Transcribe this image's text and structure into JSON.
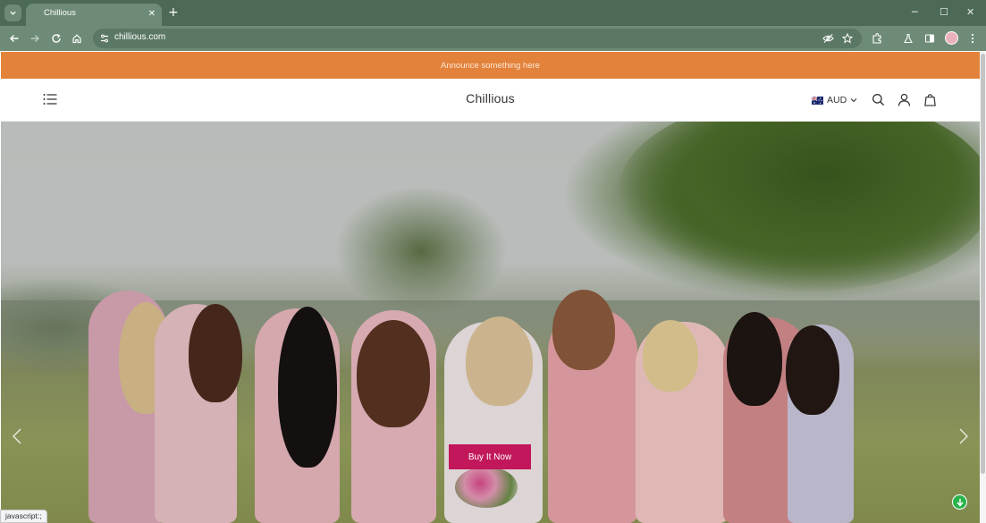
{
  "browser": {
    "tab": {
      "title": "Chillious"
    },
    "address_bar": {
      "url": "chillious.com"
    },
    "status_text": "javascript:;"
  },
  "announcement": {
    "text": "Announce something here"
  },
  "header": {
    "logo": "Chillious",
    "currency": {
      "code": "AUD",
      "flag": "australia-flag-icon"
    }
  },
  "hero": {
    "cta_label": "Buy It Now",
    "cta_color": "#c2185b",
    "prev_icon": "chevron-left-icon",
    "next_icon": "chevron-right-icon"
  },
  "colors": {
    "announcement_bg": "#e3823b",
    "browser_chrome": "#6d8b76",
    "browser_tabstrip": "#4c6a55"
  }
}
